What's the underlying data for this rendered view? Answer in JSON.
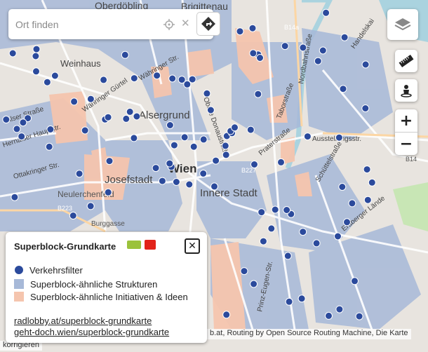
{
  "search": {
    "placeholder": "Ort finden",
    "locate_icon": "crosshair-icon",
    "clear_icon": "close-icon",
    "route_icon": "directions-icon"
  },
  "controls": {
    "layers_icon": "layers-icon",
    "ruler_icon": "ruler-icon",
    "pegman_icon": "person-icon",
    "zoom_in": "+",
    "zoom_out": "−"
  },
  "map": {
    "labels": [
      {
        "text": "Oberdöbling",
        "kind": "district"
      },
      {
        "text": "Brigittenau",
        "kind": "district"
      },
      {
        "text": "Weinhaus",
        "kind": "district"
      },
      {
        "text": "Alsergrund",
        "kind": "district"
      },
      {
        "text": "Wien",
        "kind": "city"
      },
      {
        "text": "Josefstadt",
        "kind": "district"
      },
      {
        "text": "Neulerchenfeld",
        "kind": "district"
      },
      {
        "text": "Innere Stadt",
        "kind": "district"
      },
      {
        "text": "B14a",
        "kind": "road-shield"
      },
      {
        "text": "B227",
        "kind": "road-shield"
      },
      {
        "text": "B223",
        "kind": "road-shield"
      },
      {
        "text": "B14",
        "kind": "road-shield"
      },
      {
        "text": "Handelskai",
        "kind": "street"
      },
      {
        "text": "Ausstellungsstr.",
        "kind": "street"
      },
      {
        "text": "Praterstraße",
        "kind": "street"
      },
      {
        "text": "Erdberger Lände",
        "kind": "street"
      },
      {
        "text": "Schüttelstraße",
        "kind": "street"
      },
      {
        "text": "Prinz-Eugen-Str.",
        "kind": "street"
      },
      {
        "text": "Ottakringer Str.",
        "kind": "street"
      },
      {
        "text": "Währinger Gürtel",
        "kind": "street"
      },
      {
        "text": "Währinger Str.",
        "kind": "street"
      },
      {
        "text": "Nordbahnstraße",
        "kind": "street"
      },
      {
        "text": "Taborstraße",
        "kind": "street"
      },
      {
        "text": "Obere Donaustraße",
        "kind": "street"
      },
      {
        "text": "Alser Straße",
        "kind": "street"
      },
      {
        "text": "Burggasse",
        "kind": "street"
      },
      {
        "text": "Hernalser Hauptstr.",
        "kind": "street"
      }
    ],
    "colors": {
      "base": "#e8e4df",
      "blocks": "#dcd7d0",
      "superblock_similar": "#a7b9d8",
      "initiatives": "#f5c5ae",
      "filter_dot": "#2b4a9c",
      "water": "#aad3df",
      "park": "#c8e6b5"
    }
  },
  "legend": {
    "title": "Superblock-Grundkarte",
    "close_label": "✕",
    "items": [
      {
        "label": "Verkehrsfilter",
        "swatch": "dot"
      },
      {
        "label": "Superblock-ähnliche Strukturen",
        "swatch": "blue"
      },
      {
        "label": "Superblock-ähnliche Initiativen & Ideen",
        "swatch": "orange"
      }
    ],
    "links": [
      "radlobby.at/superblock-grundkarte",
      "geht-doch.wien/superblock-grundkarte"
    ]
  },
  "attribution": {
    "text": "b.at, Routing by Open Source Routing Machine, Die Karte",
    "left_text": "korrigieren"
  }
}
